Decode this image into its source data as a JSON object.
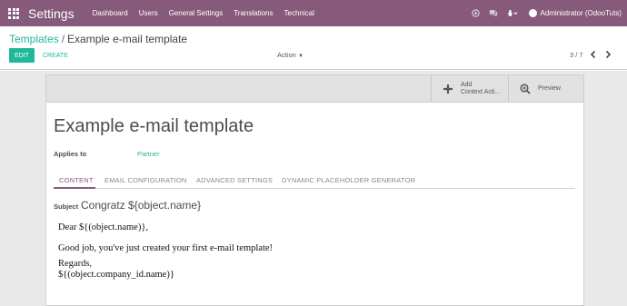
{
  "navbar": {
    "brand": "Settings",
    "menu": [
      "Dashboard",
      "Users",
      "General Settings",
      "Translations",
      "Technical"
    ],
    "user": "Administrator (OdooTuts)",
    "icons": [
      "apps-grid-icon",
      "help-icon",
      "chat-icon",
      "bug-icon"
    ],
    "color": "#875a7b"
  },
  "breadcrumb": {
    "parent": "Templates",
    "separator": "/",
    "current": "Example e-mail template"
  },
  "toolbar": {
    "edit_label": "EDIT",
    "create_label": "CREATE",
    "action_label": "Action",
    "pager": "3 / 7"
  },
  "smart_buttons": {
    "add_context_line1": "Add",
    "add_context_line2": "Context Acti...",
    "preview_label": "Preview"
  },
  "record": {
    "title": "Example e-mail template",
    "applies_to_label": "Applies to",
    "applies_to_value": "Partner"
  },
  "tabs": [
    {
      "label": "CONTENT",
      "active": true
    },
    {
      "label": "EMAIL CONFIGURATION",
      "active": false
    },
    {
      "label": "ADVANCED SETTINGS",
      "active": false
    },
    {
      "label": "DYNAMIC PLACEHOLDER GENERATOR",
      "active": false
    }
  ],
  "content": {
    "subject_label": "Subject",
    "subject_value": "Congratz ${object.name}",
    "body_lines": [
      "Dear ${(object.name)},",
      "Good job, you've just created your first e-mail template!",
      "Regards,",
      "${(object.company_id.name)}"
    ]
  },
  "colors": {
    "accent": "#21b799",
    "brand": "#875a7b"
  }
}
